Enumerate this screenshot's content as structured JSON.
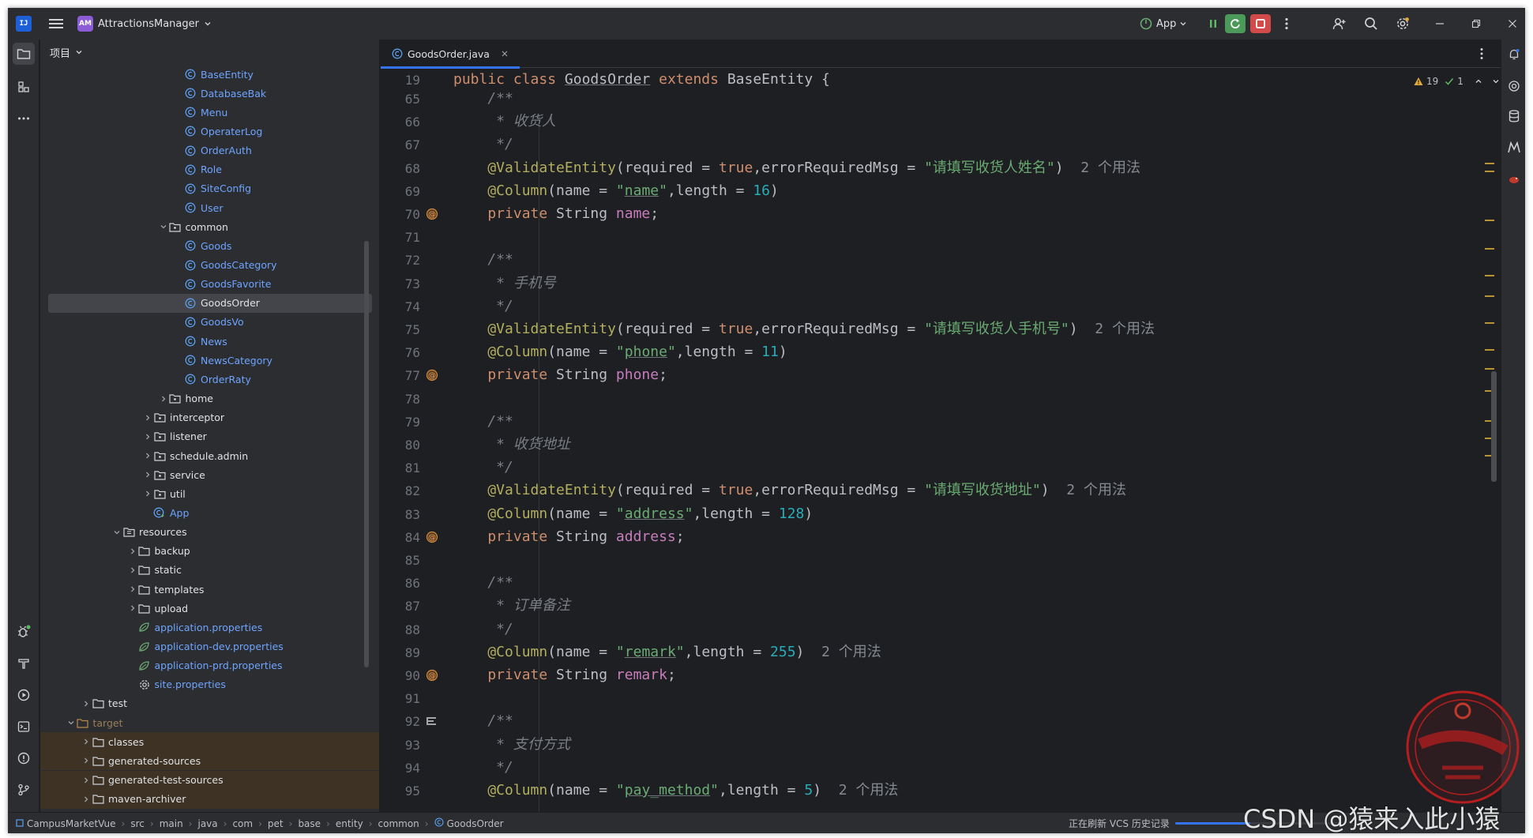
{
  "app": {
    "project_badge": "AM",
    "project_name": "AttractionsManager",
    "run_config": "App",
    "colors": {
      "accent": "#3574f0",
      "run_green": "#4c9a5a",
      "stop_red": "#d24a4a",
      "badge_purple": "#8c5bd6"
    }
  },
  "panel": {
    "title": "项目"
  },
  "tree": [
    {
      "label": "BaseEntity",
      "indent": 8,
      "type": "class"
    },
    {
      "label": "DatabaseBak",
      "indent": 8,
      "type": "class"
    },
    {
      "label": "Menu",
      "indent": 8,
      "type": "class"
    },
    {
      "label": "OperaterLog",
      "indent": 8,
      "type": "class"
    },
    {
      "label": "OrderAuth",
      "indent": 8,
      "type": "class"
    },
    {
      "label": "Role",
      "indent": 8,
      "type": "class"
    },
    {
      "label": "SiteConfig",
      "indent": 8,
      "type": "class"
    },
    {
      "label": "User",
      "indent": 8,
      "type": "class"
    },
    {
      "label": "common",
      "indent": 7,
      "type": "package",
      "expanded": true
    },
    {
      "label": "Goods",
      "indent": 8,
      "type": "class"
    },
    {
      "label": "GoodsCategory",
      "indent": 8,
      "type": "class"
    },
    {
      "label": "GoodsFavorite",
      "indent": 8,
      "type": "class"
    },
    {
      "label": "GoodsOrder",
      "indent": 8,
      "type": "class",
      "selected": true
    },
    {
      "label": "GoodsVo",
      "indent": 8,
      "type": "class"
    },
    {
      "label": "News",
      "indent": 8,
      "type": "class"
    },
    {
      "label": "NewsCategory",
      "indent": 8,
      "type": "class"
    },
    {
      "label": "OrderRaty",
      "indent": 8,
      "type": "class"
    },
    {
      "label": "home",
      "indent": 7,
      "type": "package",
      "expanded": false
    },
    {
      "label": "interceptor",
      "indent": 6,
      "type": "package",
      "expanded": false
    },
    {
      "label": "listener",
      "indent": 6,
      "type": "package",
      "expanded": false
    },
    {
      "label": "schedule.admin",
      "indent": 6,
      "type": "package",
      "expanded": false
    },
    {
      "label": "service",
      "indent": 6,
      "type": "package",
      "expanded": false
    },
    {
      "label": "util",
      "indent": 6,
      "type": "package",
      "expanded": false
    },
    {
      "label": "App",
      "indent": 6,
      "type": "app"
    },
    {
      "label": "resources",
      "indent": 4,
      "type": "resfolder",
      "expanded": true
    },
    {
      "label": "backup",
      "indent": 5,
      "type": "folder",
      "expanded": false
    },
    {
      "label": "static",
      "indent": 5,
      "type": "folder",
      "expanded": false
    },
    {
      "label": "templates",
      "indent": 5,
      "type": "folder",
      "expanded": false
    },
    {
      "label": "upload",
      "indent": 5,
      "type": "folder",
      "expanded": false
    },
    {
      "label": "application.properties",
      "indent": 5,
      "type": "spring"
    },
    {
      "label": "application-dev.properties",
      "indent": 5,
      "type": "spring"
    },
    {
      "label": "application-prd.properties",
      "indent": 5,
      "type": "spring"
    },
    {
      "label": "site.properties",
      "indent": 5,
      "type": "gearprop"
    },
    {
      "label": "test",
      "indent": 2,
      "type": "folder",
      "expanded": false
    },
    {
      "label": "target",
      "indent": 1,
      "type": "target",
      "expanded": true
    },
    {
      "label": "classes",
      "indent": 2,
      "type": "folder",
      "expanded": false,
      "excluded": true
    },
    {
      "label": "generated-sources",
      "indent": 2,
      "type": "folder",
      "expanded": false,
      "excluded": true
    },
    {
      "label": "generated-test-sources",
      "indent": 2,
      "type": "folder",
      "expanded": false,
      "excluded": true
    },
    {
      "label": "maven-archiver",
      "indent": 2,
      "type": "folder",
      "expanded": false,
      "excluded": true
    }
  ],
  "editor": {
    "tab_label": "GoodsOrder.java",
    "inspection": {
      "warnings": "19",
      "checks": "1"
    },
    "sticky_line": {
      "n": "19",
      "t": [
        [
          "kw",
          "public class "
        ],
        [
          "plain uline",
          "GoodsOrder"
        ],
        [
          "kw",
          " extends "
        ],
        [
          "plain",
          "BaseEntity {"
        ]
      ]
    },
    "lines": [
      {
        "n": "65",
        "t": [
          [
            "cmt",
            "    /**"
          ]
        ]
      },
      {
        "n": "66",
        "t": [
          [
            "cmt",
            "     * 收货人"
          ]
        ]
      },
      {
        "n": "67",
        "t": [
          [
            "cmt",
            "     */"
          ]
        ]
      },
      {
        "n": "68",
        "t": [
          [
            "ann",
            "    @ValidateEntity"
          ],
          [
            "plain",
            "(required = "
          ],
          [
            "kw",
            "true"
          ],
          [
            "plain",
            ",errorRequiredMsg = "
          ],
          [
            "str",
            "\"请填写收货人姓名\""
          ],
          [
            "plain",
            ")"
          ],
          [
            "hint",
            "  2 个用法"
          ]
        ]
      },
      {
        "n": "69",
        "t": [
          [
            "ann",
            "    @Column"
          ],
          [
            "plain",
            "(name = "
          ],
          [
            "str",
            "\""
          ],
          [
            "str uline",
            "name"
          ],
          [
            "str",
            "\""
          ],
          [
            "plain",
            ",length = "
          ],
          [
            "num",
            "16"
          ],
          [
            "plain",
            ")"
          ]
        ]
      },
      {
        "n": "70",
        "m": "at",
        "t": [
          [
            "kw",
            "    private "
          ],
          [
            "plain",
            "String "
          ],
          [
            "fld",
            "name"
          ],
          [
            "plain",
            ";"
          ]
        ]
      },
      {
        "n": "71",
        "t": []
      },
      {
        "n": "72",
        "t": [
          [
            "cmt",
            "    /**"
          ]
        ]
      },
      {
        "n": "73",
        "t": [
          [
            "cmt",
            "     * 手机号"
          ]
        ]
      },
      {
        "n": "74",
        "t": [
          [
            "cmt",
            "     */"
          ]
        ]
      },
      {
        "n": "75",
        "t": [
          [
            "ann",
            "    @ValidateEntity"
          ],
          [
            "plain",
            "(required = "
          ],
          [
            "kw",
            "true"
          ],
          [
            "plain",
            ",errorRequiredMsg = "
          ],
          [
            "str",
            "\"请填写收货人手机号\""
          ],
          [
            "plain",
            ")"
          ],
          [
            "hint",
            "  2 个用法"
          ]
        ]
      },
      {
        "n": "76",
        "t": [
          [
            "ann",
            "    @Column"
          ],
          [
            "plain",
            "(name = "
          ],
          [
            "str",
            "\""
          ],
          [
            "str uline",
            "phone"
          ],
          [
            "str",
            "\""
          ],
          [
            "plain",
            ",length = "
          ],
          [
            "num",
            "11"
          ],
          [
            "plain",
            ")"
          ]
        ]
      },
      {
        "n": "77",
        "m": "at",
        "t": [
          [
            "kw",
            "    private "
          ],
          [
            "plain",
            "String "
          ],
          [
            "fld",
            "phone"
          ],
          [
            "plain",
            ";"
          ]
        ]
      },
      {
        "n": "78",
        "t": []
      },
      {
        "n": "79",
        "t": [
          [
            "cmt",
            "    /**"
          ]
        ]
      },
      {
        "n": "80",
        "t": [
          [
            "cmt",
            "     * 收货地址"
          ]
        ]
      },
      {
        "n": "81",
        "t": [
          [
            "cmt",
            "     */"
          ]
        ]
      },
      {
        "n": "82",
        "t": [
          [
            "ann",
            "    @ValidateEntity"
          ],
          [
            "plain",
            "(required = "
          ],
          [
            "kw",
            "true"
          ],
          [
            "plain",
            ",errorRequiredMsg = "
          ],
          [
            "str",
            "\"请填写收货地址\""
          ],
          [
            "plain",
            ")"
          ],
          [
            "hint",
            "  2 个用法"
          ]
        ]
      },
      {
        "n": "83",
        "t": [
          [
            "ann",
            "    @Column"
          ],
          [
            "plain",
            "(name = "
          ],
          [
            "str",
            "\""
          ],
          [
            "str uline",
            "address"
          ],
          [
            "str",
            "\""
          ],
          [
            "plain",
            ",length = "
          ],
          [
            "num",
            "128"
          ],
          [
            "plain",
            ")"
          ]
        ]
      },
      {
        "n": "84",
        "m": "at",
        "t": [
          [
            "kw",
            "    private "
          ],
          [
            "plain",
            "String "
          ],
          [
            "fld",
            "address"
          ],
          [
            "plain",
            ";"
          ]
        ]
      },
      {
        "n": "85",
        "t": []
      },
      {
        "n": "86",
        "t": [
          [
            "cmt",
            "    /**"
          ]
        ]
      },
      {
        "n": "87",
        "t": [
          [
            "cmt",
            "     * 订单备注"
          ]
        ]
      },
      {
        "n": "88",
        "t": [
          [
            "cmt",
            "     */"
          ]
        ]
      },
      {
        "n": "89",
        "t": [
          [
            "ann",
            "    @Column"
          ],
          [
            "plain",
            "(name = "
          ],
          [
            "str",
            "\""
          ],
          [
            "str uline",
            "remark"
          ],
          [
            "str",
            "\""
          ],
          [
            "plain",
            ",length = "
          ],
          [
            "num",
            "255"
          ],
          [
            "plain",
            ")"
          ],
          [
            "hint",
            "  2 个用法"
          ]
        ]
      },
      {
        "n": "90",
        "m": "at",
        "t": [
          [
            "kw",
            "    private "
          ],
          [
            "plain",
            "String "
          ],
          [
            "fld",
            "remark"
          ],
          [
            "plain",
            ";"
          ]
        ]
      },
      {
        "n": "91",
        "t": []
      },
      {
        "n": "92",
        "m": "list",
        "t": [
          [
            "cmt",
            "    /**"
          ]
        ]
      },
      {
        "n": "93",
        "t": [
          [
            "cmt",
            "     * 支付方式"
          ]
        ]
      },
      {
        "n": "94",
        "t": [
          [
            "cmt",
            "     */"
          ]
        ]
      },
      {
        "n": "95",
        "t": [
          [
            "ann",
            "    @Column"
          ],
          [
            "plain",
            "(name = "
          ],
          [
            "str",
            "\""
          ],
          [
            "str uline",
            "pay_method"
          ],
          [
            "str",
            "\""
          ],
          [
            "plain",
            ",length = "
          ],
          [
            "num",
            "5"
          ],
          [
            "plain",
            ")"
          ],
          [
            "hint",
            "  2 个用法"
          ]
        ]
      }
    ]
  },
  "statusbar": {
    "crumbs": [
      "CampusMarketVue",
      "src",
      "main",
      "java",
      "com",
      "pet",
      "base",
      "entity",
      "common",
      "GoodsOrder"
    ],
    "status": "正在刷新 VCS 历史记录",
    "progress": 0.45
  }
}
